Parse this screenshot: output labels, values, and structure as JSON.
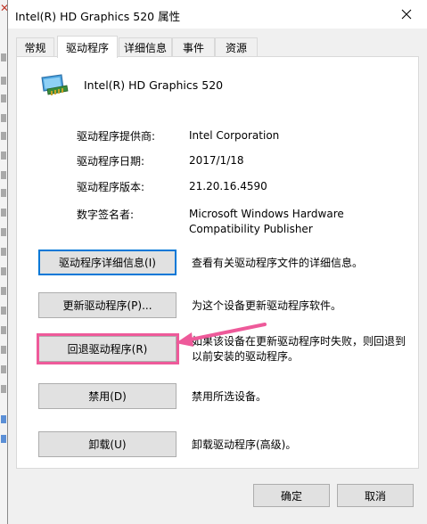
{
  "window": {
    "title": "Intel(R) HD Graphics 520 属性"
  },
  "tabs": [
    {
      "label": "常规"
    },
    {
      "label": "驱动程序"
    },
    {
      "label": "详细信息"
    },
    {
      "label": "事件"
    },
    {
      "label": "资源"
    }
  ],
  "active_tab": "驱动程序",
  "device": {
    "name": "Intel(R) HD Graphics 520",
    "icon": "display-adapter-icon"
  },
  "info": [
    {
      "label": "驱动程序提供商:",
      "value": "Intel Corporation"
    },
    {
      "label": "驱动程序日期:",
      "value": "2017/1/18"
    },
    {
      "label": "驱动程序版本:",
      "value": "21.20.16.4590"
    },
    {
      "label": "数字签名者:",
      "value_line1": "Microsoft Windows Hardware",
      "value_line2": "Compatibility Publisher"
    }
  ],
  "actions": [
    {
      "label": "驱动程序详细信息(I)",
      "desc": "查看有关驱动程序文件的详细信息。"
    },
    {
      "label": "更新驱动程序(P)...",
      "desc": "为这个设备更新驱动程序软件。"
    },
    {
      "label": "回退驱动程序(R)",
      "desc_line1": "如果该设备在更新驱动程序时失败，则回退到",
      "desc_line2": "以前安装的驱动程序。"
    },
    {
      "label": "禁用(D)",
      "desc": "禁用所选设备。"
    },
    {
      "label": "卸载(U)",
      "desc": "卸载驱动程序(高级)。"
    }
  ],
  "footer": {
    "ok_label": "确定",
    "cancel_label": "取消"
  },
  "colors": {
    "highlight": "#ee5a9a",
    "focus": "#0078d7",
    "button": "#e1e1e1"
  }
}
